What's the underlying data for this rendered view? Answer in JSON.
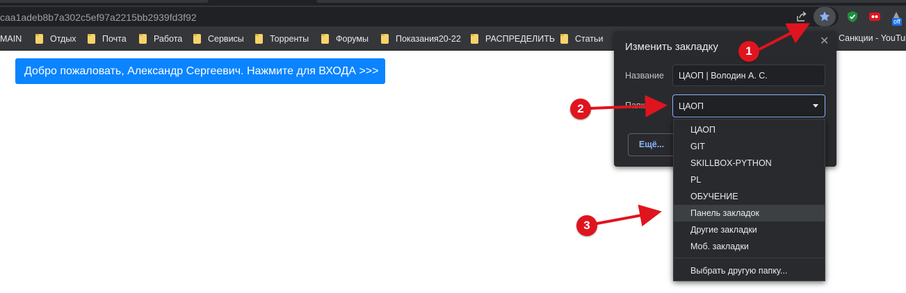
{
  "address_bar": {
    "url": "caa1adeb8b7a302c5ef97a2215bb2939fd3f92"
  },
  "extensions": {
    "off_badge": "off"
  },
  "bookmarks": [
    {
      "label": "MAIN"
    },
    {
      "label": "Отдых"
    },
    {
      "label": "Почта"
    },
    {
      "label": "Работа"
    },
    {
      "label": "Сервисы"
    },
    {
      "label": "Торренты"
    },
    {
      "label": "Форумы"
    },
    {
      "label": "Показания20-22"
    },
    {
      "label": "РАСПРЕДЕЛИТЬ"
    },
    {
      "label": "Статьи"
    },
    {
      "label": "Санкции - YouTube"
    }
  ],
  "page": {
    "login_button": "Добро пожаловать, Александр Сергеевич. Нажмите для ВХОДА >>>"
  },
  "dialog": {
    "title": "Изменить закладку",
    "name_label": "Название",
    "name_value": "ЦАОП | Володин А. С.",
    "folder_label": "Папка",
    "folder_value": "ЦАОП",
    "more_button": "Ещё..."
  },
  "dropdown": {
    "options": [
      "ЦАОП",
      "GIT",
      "SKILLBOX-PYTHON",
      "PL",
      "ОБУЧЕНИЕ",
      "Панель закладок",
      "Другие закладки",
      "Моб. закладки"
    ],
    "highlighted": "Панель закладок",
    "choose_other": "Выбрать другую папку..."
  },
  "annotations": {
    "badges": [
      "1",
      "2",
      "3"
    ],
    "color": "#e0141e"
  },
  "colors": {
    "accent": "#0a84ff",
    "star": "#8ab4f8"
  }
}
